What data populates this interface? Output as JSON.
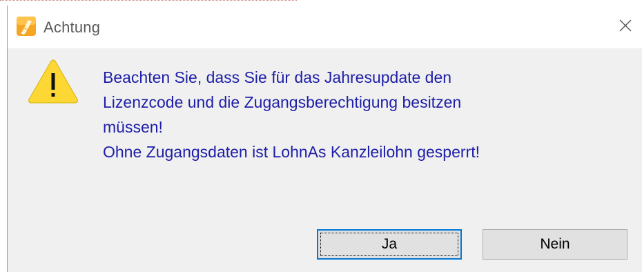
{
  "window": {
    "title": "Achtung",
    "close_symbol": "✕"
  },
  "icons": {
    "app_icon": "app-logo-icon",
    "warning_icon": "warning-icon",
    "close_icon": "close-icon",
    "warning_color": "#fdd835",
    "app_icon_color": "#f5a623"
  },
  "message": {
    "lines": [
      "Beachten Sie, dass Sie für das Jahresupdate den",
      "Lizenzcode und die Zugangsberechtigung besitzen",
      "müssen!",
      "Ohne Zugangsdaten ist LohnAs Kanzleilohn gesperrt!"
    ],
    "color": "#1e1ea8"
  },
  "buttons": {
    "yes_label": "Ja",
    "no_label": "Nein",
    "focused": "Ja",
    "accent": "#0078d7"
  }
}
